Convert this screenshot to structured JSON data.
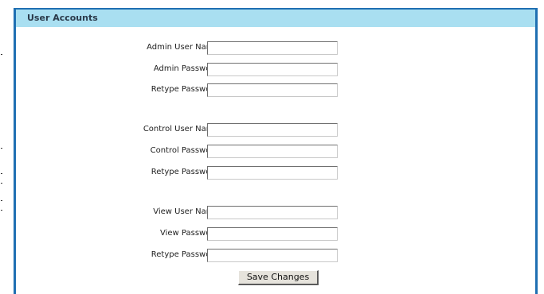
{
  "panel": {
    "title": "User Accounts"
  },
  "groups": [
    {
      "fields": [
        {
          "label": "Admin User Name:",
          "value": "",
          "type": "text"
        },
        {
          "label": "Admin Password:",
          "value": "",
          "type": "password"
        },
        {
          "label": "Retype Password:",
          "value": "",
          "type": "password"
        }
      ]
    },
    {
      "fields": [
        {
          "label": "Control User Name:",
          "value": "",
          "type": "text"
        },
        {
          "label": "Control Password:",
          "value": "",
          "type": "password"
        },
        {
          "label": "Retype Password:",
          "value": "",
          "type": "password"
        }
      ]
    },
    {
      "fields": [
        {
          "label": "View User Name:",
          "value": "",
          "type": "text"
        },
        {
          "label": "View Password:",
          "value": "",
          "type": "password"
        },
        {
          "label": "Retype Password:",
          "value": "",
          "type": "password"
        }
      ]
    }
  ],
  "actions": {
    "save_label": "Save Changes"
  },
  "colors": {
    "panel_border": "#1f6fb2",
    "header_background": "#a9dff1",
    "button_face": "#e6e3dc"
  }
}
